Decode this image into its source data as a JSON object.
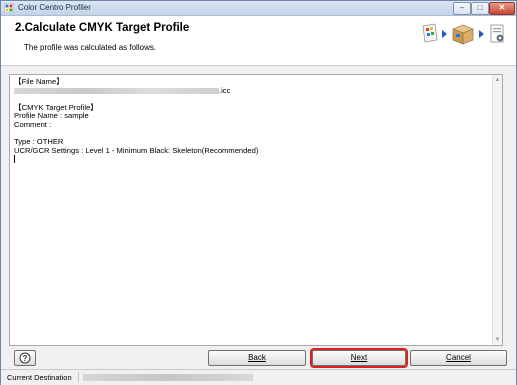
{
  "window": {
    "title": "Color Centro Profiler"
  },
  "header": {
    "title": "2.Calculate CMYK Target Profile",
    "description": "The profile was calculated as follows.",
    "flow_icons": [
      "printer-color-icon",
      "arrow-right-icon",
      "box-package-icon",
      "arrow-right-icon",
      "document-gear-icon"
    ]
  },
  "content": {
    "file_name_heading": "【File Name】",
    "file_extension": ".icc",
    "cmyk_heading": "【CMYK Target Profile】",
    "profile_name": "Profile Name : sample",
    "comment": "Comment :",
    "type": "Type : OTHER",
    "ucr_gcr": "UCR/GCR Settings : Level 1 - Minimum Black: Skeleton(Recommended)"
  },
  "buttons": {
    "help": "?",
    "back": "Back",
    "next": "Next",
    "cancel": "Cancel"
  },
  "status": {
    "label": "Current Destination"
  },
  "colors": {
    "highlight": "#e01e1e",
    "accent": "#1a5fb4"
  }
}
